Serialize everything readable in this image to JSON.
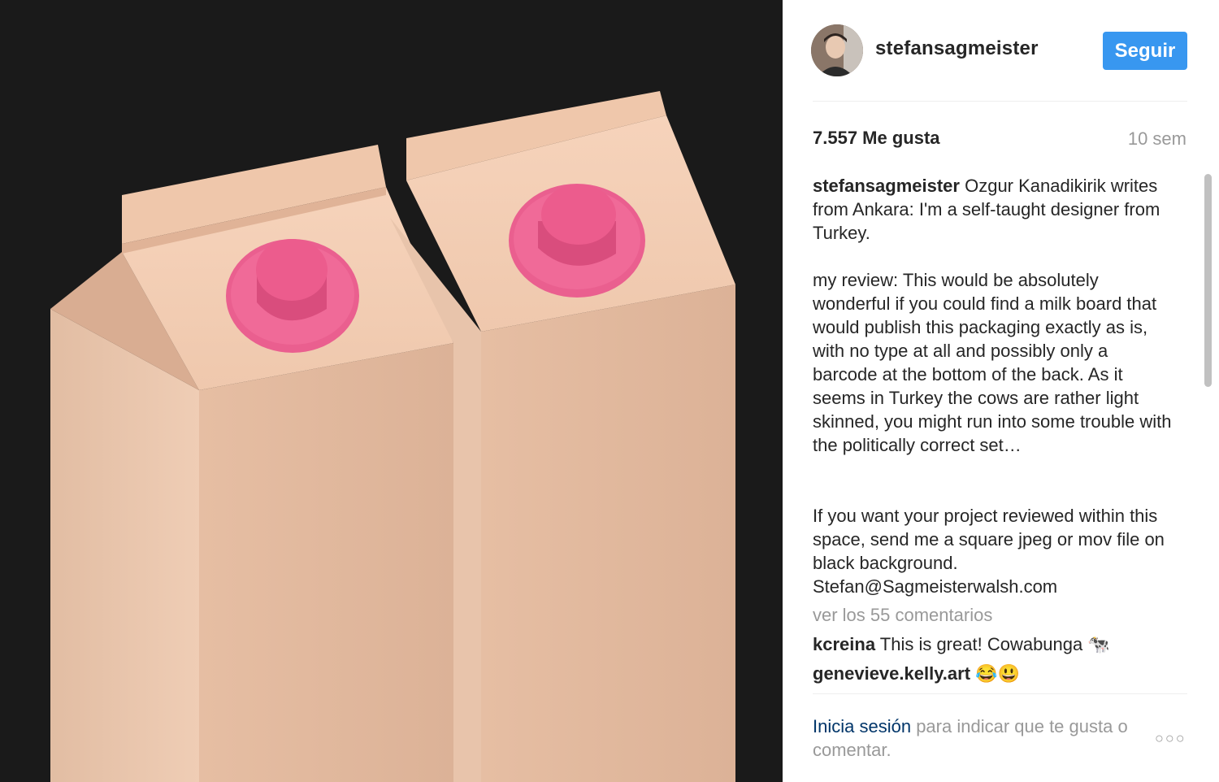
{
  "header": {
    "username": "stefansagmeister",
    "follow_label": "Seguir"
  },
  "stats": {
    "likes": "7.557 Me gusta",
    "time_ago": "10 sem"
  },
  "caption": {
    "username": "stefansagmeister",
    "text": " Ozgur Kanadikirik writes from Ankara: I'm a self-taught designer from Turkey.\n\nmy review: This would be absolutely wonderful if you could find a milk board that would publish this packaging exactly as is, with no type at all and possibly only a barcode at the bottom of the back. As it seems in Turkey the cows are rather light skinned, you might run into some trouble with the politically correct set…\n\n\nIf you want your project reviewed within this space, send me a square jpeg or mov file on black background. Stefan@Sagmeisterwalsh.com"
  },
  "view_all_comments": "ver los 55 comentarios",
  "comments": [
    {
      "username": "kcreina",
      "text": " This is great! Cowabunga 🐄"
    },
    {
      "username": "genevieve.kelly.art",
      "text": " 😂😃"
    }
  ],
  "footer": {
    "login_link": "Inicia sesión",
    "login_rest": " para indicar que te gusta o comentar.",
    "more_label": "○○○"
  },
  "colors": {
    "accent": "#3897f0",
    "media_background": "#1a1a1a",
    "carton": "#e8c3a8",
    "cap": "#ea5f8f"
  }
}
